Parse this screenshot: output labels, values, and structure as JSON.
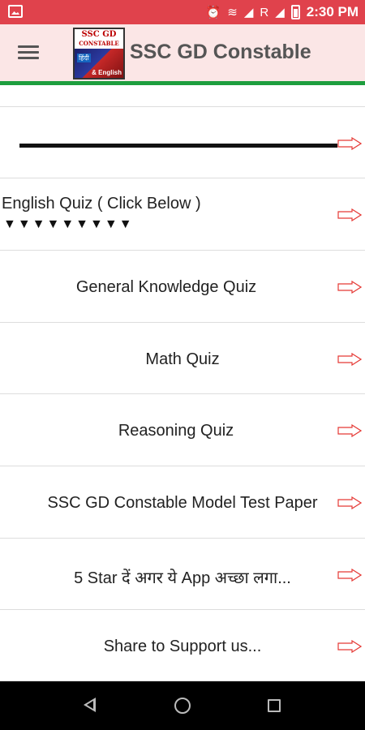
{
  "status_bar": {
    "time": "2:30 PM",
    "signal_label": "R",
    "icons": [
      "gallery-icon",
      "alarm-icon",
      "wifi-icon",
      "signal-icon",
      "battery-icon"
    ]
  },
  "toolbar": {
    "title": "SSC GD Constable",
    "logo_text_top": "SSC GD",
    "logo_text_mid": "CONSTABLE",
    "logo_tag_hindi": "हिंदी",
    "logo_tag_english": "& English"
  },
  "list": {
    "items": [
      {
        "id": "divider-item",
        "label": ""
      },
      {
        "id": "english-quiz",
        "label": "English Quiz ( Click Below )",
        "sub": "▼▼▼▼▼▼▼▼▼"
      },
      {
        "id": "gk-quiz",
        "label": "General Knowledge Quiz"
      },
      {
        "id": "math-quiz",
        "label": "Math Quiz"
      },
      {
        "id": "reasoning-quiz",
        "label": "Reasoning Quiz"
      },
      {
        "id": "model-test",
        "label": "SSC GD Constable Model Test Paper"
      },
      {
        "id": "rate-app",
        "label": "5 Star दें अगर ये App अच्छा लगा..."
      },
      {
        "id": "share",
        "label": "Share to Support us..."
      }
    ]
  },
  "colors": {
    "status_bar": "#e0424c",
    "toolbar": "#fbe6e6",
    "accent_line": "#1e9e3e",
    "arrow": "#e53935"
  }
}
